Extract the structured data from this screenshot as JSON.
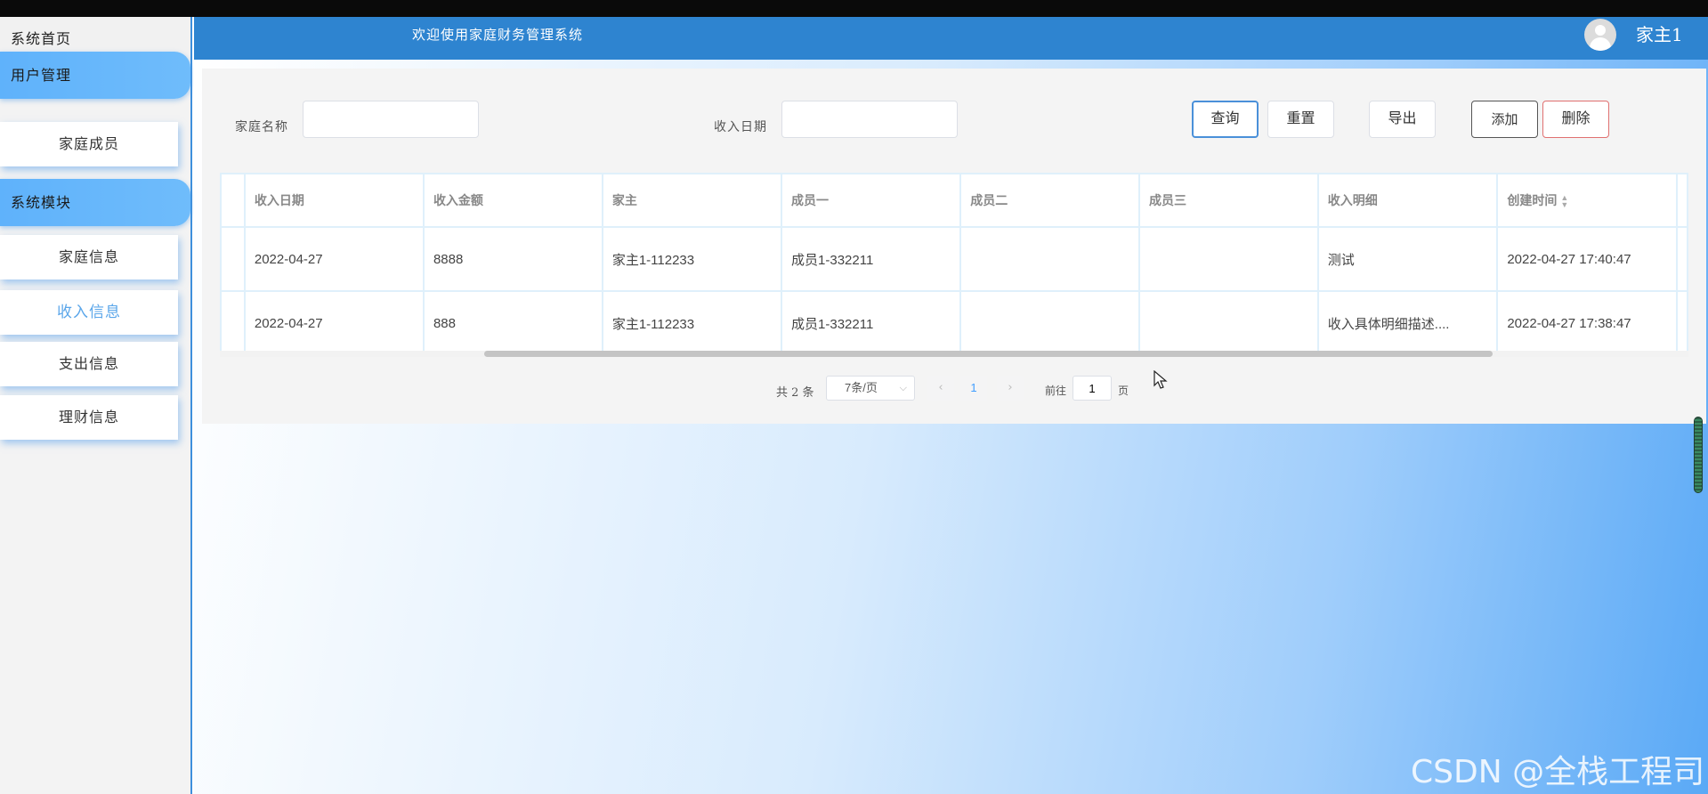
{
  "sidebar": {
    "home": "系统首页",
    "groups": [
      {
        "label": "用户管理",
        "items": [
          "家庭成员"
        ]
      },
      {
        "label": "系统模块",
        "items": [
          "家庭信息",
          "收入信息",
          "支出信息",
          "理财信息"
        ]
      }
    ],
    "active_item": "收入信息"
  },
  "header": {
    "title": "欢迎使用家庭财务管理系统",
    "user_name": "家主1",
    "avatar_icon": "user-avatar-icon"
  },
  "search": {
    "family_name_label": "家庭名称",
    "family_name_value": "",
    "income_date_label": "收入日期",
    "income_date_value": ""
  },
  "toolbar": {
    "query": "查询",
    "reset": "重置",
    "export": "导出",
    "add": "添加",
    "delete": "删除"
  },
  "table": {
    "columns": [
      "收入日期",
      "收入金额",
      "家主",
      "成员一",
      "成员二",
      "成员三",
      "收入明细",
      "创建时间"
    ],
    "rows": [
      [
        "2022-04-27",
        "8888",
        "家主1-112233",
        "成员1-332211",
        "",
        "",
        "测试",
        "2022-04-27 17:40:47"
      ],
      [
        "2022-04-27",
        "888",
        "家主1-112233",
        "成员1-332211",
        "",
        "",
        "收入具体明细描述....",
        "2022-04-27 17:38:47"
      ]
    ]
  },
  "pagination": {
    "total_text": "共 2 条",
    "page_size": "7条/页",
    "current_page": "1",
    "goto_prefix": "前往",
    "goto_value": "1",
    "goto_suffix": "页"
  },
  "watermark": "CSDN @全栈工程司",
  "colors": {
    "header_bg": "#2e84d0",
    "sidebar_group": "#5fb2fb",
    "active_text": "#5aa6ea",
    "primary_border": "#4a90d9",
    "danger_border": "#e07070"
  }
}
